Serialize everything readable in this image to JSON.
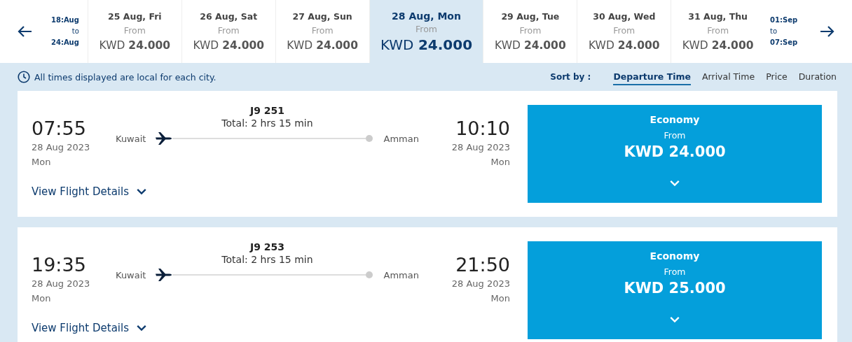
{
  "date_bar": {
    "previous_range": {
      "start": "18:Aug",
      "to": "to",
      "end": "24:Aug"
    },
    "dates": [
      {
        "label": "25 Aug, Fri",
        "from": "From",
        "price": "KWD **24.000**",
        "selected": false
      },
      {
        "label": "26 Aug, Sat",
        "from": "From",
        "price": "KWD **24.000**",
        "selected": false
      },
      {
        "label": "27 Aug, Sun",
        "from": "From",
        "price": "KWD **24.000**",
        "selected": false
      },
      {
        "label": "28 Aug, Mon",
        "from": "From",
        "price": "KWD **24.000**",
        "selected": true
      },
      {
        "label": "29 Aug, Tue",
        "from": "From",
        "price": "KWD **24.000**",
        "selected": false
      },
      {
        "label": "30 Aug, Wed",
        "from": "From",
        "price": "KWD **24.000**",
        "selected": false
      },
      {
        "label": "31 Aug, Thu",
        "from": "From",
        "price": "KWD **24.000**",
        "selected": false
      }
    ],
    "next_range": {
      "start": "01:Sep",
      "to": "to",
      "end": "07:Sep"
    }
  },
  "notice": "All times displayed are local for each city.",
  "sort": {
    "label": "Sort by :",
    "options": [
      {
        "label": "Departure Time",
        "selected": true
      },
      {
        "label": "Arrival Time",
        "selected": false
      },
      {
        "label": "Price",
        "selected": false
      },
      {
        "label": "Duration",
        "selected": false
      }
    ]
  },
  "flights": [
    {
      "departure_time": "07:55",
      "departure_date": "28 Aug 2023",
      "departure_day": "Mon",
      "origin": "Kuwait",
      "flight_number": "J9 251",
      "duration": "Total: 2 hrs 15 min",
      "destination": "Amman",
      "arrival_time": "10:10",
      "arrival_date": "28 Aug 2023",
      "arrival_day": "Mon",
      "details_link": "View Flight Details",
      "fare": {
        "cabin": "Economy",
        "from": "From",
        "price": "KWD 24.000"
      }
    },
    {
      "departure_time": "19:35",
      "departure_date": "28 Aug 2023",
      "departure_day": "Mon",
      "origin": "Kuwait",
      "flight_number": "J9 253",
      "duration": "Total: 2 hrs 15 min",
      "destination": "Amman",
      "arrival_time": "21:50",
      "arrival_date": "28 Aug 2023",
      "arrival_day": "Mon",
      "details_link": "View Flight Details",
      "fare": {
        "cabin": "Economy",
        "from": "From",
        "price": "KWD 25.000"
      }
    }
  ]
}
